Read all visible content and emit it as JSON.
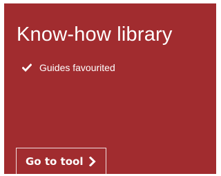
{
  "card": {
    "title": "Know-how library",
    "background_color": "#a12c2f",
    "features": [
      {
        "icon": "check-icon",
        "label": "Guides favourited"
      }
    ],
    "cta": {
      "label": "Go to tool",
      "icon": "chevron-right-icon"
    }
  }
}
